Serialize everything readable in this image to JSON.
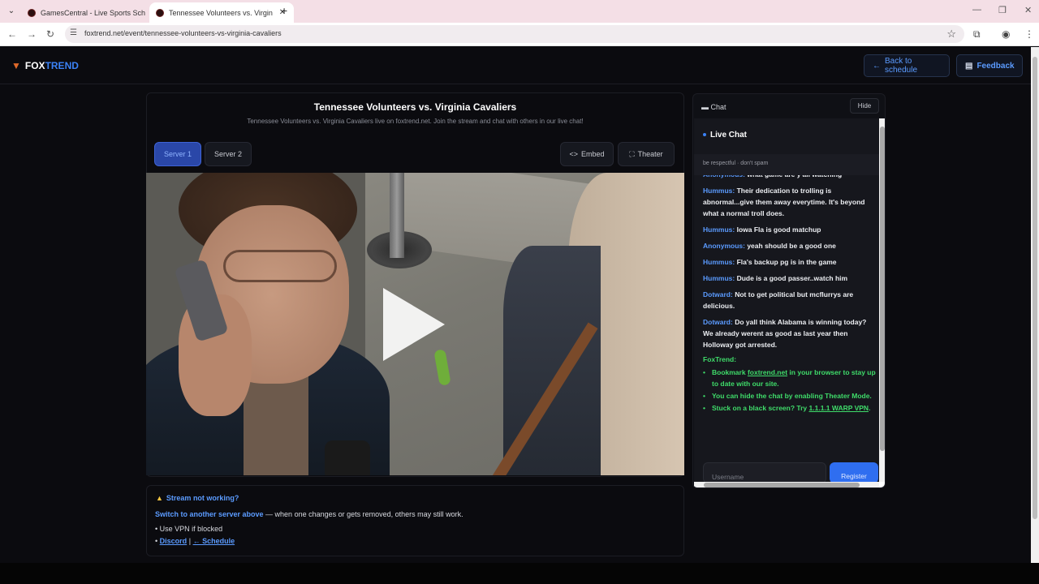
{
  "browser": {
    "tabs": [
      {
        "title": "GamesCentral - Live Sports Sch"
      },
      {
        "title": "Tennessee Volunteers vs. Virgin"
      }
    ],
    "url": "foxtrend.net/event/tennessee-volunteers-vs-virginia-cavaliers"
  },
  "header": {
    "logo_part1": "FOX",
    "logo_part2": "TREND",
    "back_label": "Back to schedule",
    "feedback_label": "Feedback"
  },
  "event": {
    "title": "Tennessee Volunteers vs. Virginia Cavaliers",
    "subtitle": "Tennessee Volunteers vs. Virginia Cavaliers live on foxtrend.net. Join the stream and chat with others in our live chat!"
  },
  "controls": {
    "server1": "Server 1",
    "server2": "Server 2",
    "embed": "Embed",
    "theater": "Theater"
  },
  "info": {
    "heading": "Stream not working?",
    "switch_link": "Switch to another server above",
    "switch_rest": " — when one changes or gets removed, others may still work.",
    "vpn": "• Use VPN if blocked",
    "bullet": "•",
    "discord": "Discord",
    "sep": "|",
    "schedule": "← Schedule"
  },
  "chat": {
    "label": "Chat",
    "hide": "Hide",
    "title": "Live Chat",
    "rules": "be respectful · don't spam",
    "messages": [
      {
        "user": "Anonymous:",
        "text": "what game are y'all watching"
      },
      {
        "user": "Hummus:",
        "text": "Their dedication to trolling is abnormal...give them away everytime. It's beyond what a normal troll does."
      },
      {
        "user": "Hummus:",
        "text": "Iowa Fla is good matchup"
      },
      {
        "user": "Anonymous:",
        "text": "yeah should be a good one"
      },
      {
        "user": "Hummus:",
        "text": "Fla's backup pg is in the game"
      },
      {
        "user": "Hummus:",
        "text": "Dude is a good passer..watch him"
      },
      {
        "user": "Dotward:",
        "text": "Not to get political but mcflurrys are delicious."
      },
      {
        "user": "Dotward:",
        "text": "Do yall think Alabama is winning today? We already werent as good as last year then Holloway got arrested."
      }
    ],
    "foxtrend_label": "FoxTrend:",
    "tips": {
      "t1_pre": "Bookmark ",
      "t1_link": "foxtrend.net",
      "t1_post": " in your browser to stay up to date with our site.",
      "t2": "You can hide the chat by enabling Theater Mode.",
      "t3_pre": "Stuck on a black screen? Try ",
      "t3_link": "1.1.1.1 WARP VPN",
      "t3_post": "."
    },
    "username_placeholder": "Username",
    "register": "Register"
  },
  "colors": {
    "accent": "#3b82f6",
    "foxtrend_green": "#3fdc6a",
    "background": "#0b0b0f"
  }
}
